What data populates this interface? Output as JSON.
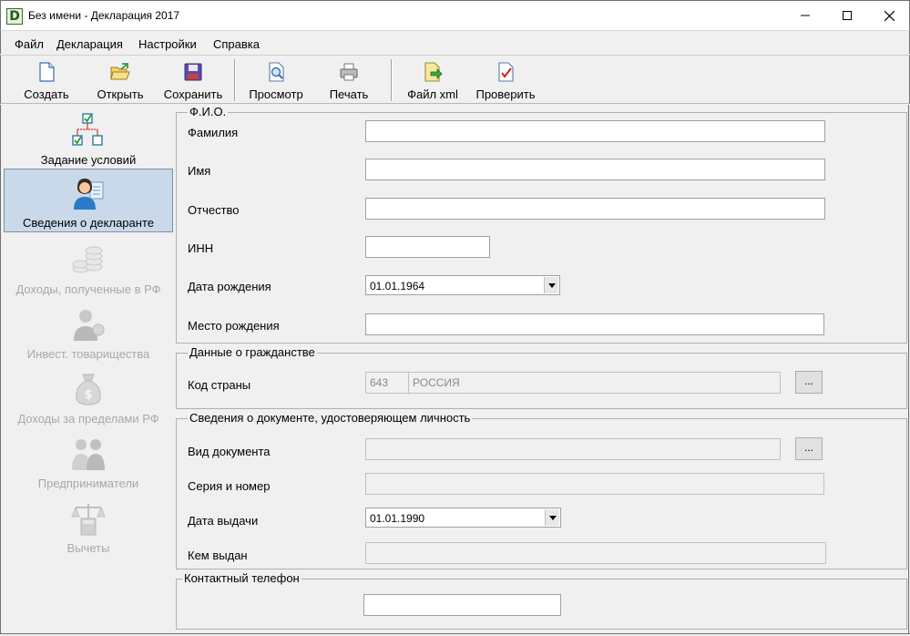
{
  "window": {
    "app_icon_letter": "D",
    "title": "Без имени - Декларация 2017"
  },
  "menu": [
    "Файл",
    "Декларация",
    "Настройки",
    "Справка"
  ],
  "toolbar": {
    "create": "Создать",
    "open": "Открыть",
    "save": "Сохранить",
    "preview": "Просмотр",
    "print": "Печать",
    "xml": "Файл xml",
    "check": "Проверить"
  },
  "sidebar": {
    "items": [
      {
        "label": "Задание условий",
        "icon": "hierarchy-checkbox-icon",
        "state": "normal"
      },
      {
        "label": "Сведения о декларанте",
        "icon": "person-card-icon",
        "state": "selected"
      },
      {
        "label": "Доходы, полученные в РФ",
        "icon": "coins-stack-icon",
        "state": "disabled"
      },
      {
        "label": "Инвест. товарищества",
        "icon": "businessman-icon",
        "state": "disabled"
      },
      {
        "label": "Доходы за пределами РФ",
        "icon": "money-bag-icon",
        "state": "disabled"
      },
      {
        "label": "Предприниматели",
        "icon": "handshake-icon",
        "state": "disabled"
      },
      {
        "label": "Вычеты",
        "icon": "scales-calculator-icon",
        "state": "disabled"
      }
    ]
  },
  "fio": {
    "title": "Ф.И.О.",
    "surname_label": "Фамилия",
    "surname_value": "",
    "name_label": "Имя",
    "name_value": "",
    "patronymic_label": "Отчество",
    "patronymic_value": "",
    "inn_label": "ИНН",
    "inn_value": "",
    "birthdate_label": "Дата рождения",
    "birthdate_value": "01.01.1964",
    "birthplace_label": "Место рождения",
    "birthplace_value": ""
  },
  "citizenship": {
    "title": "Данные о гражданстве",
    "country_label": "Код страны",
    "country_code": "643",
    "country_name": "РОССИЯ",
    "browse": "..."
  },
  "document": {
    "title": "Сведения о документе, удостоверяющем личность",
    "type_label": "Вид документа",
    "type_value": "",
    "browse": "...",
    "series_label": "Серия и номер",
    "series_value": "",
    "issue_date_label": "Дата выдачи",
    "issue_date_value": "01.01.1990",
    "issued_by_label": "Кем выдан",
    "issued_by_value": ""
  },
  "contact": {
    "title": "Контактный телефон",
    "phone_value": ""
  }
}
